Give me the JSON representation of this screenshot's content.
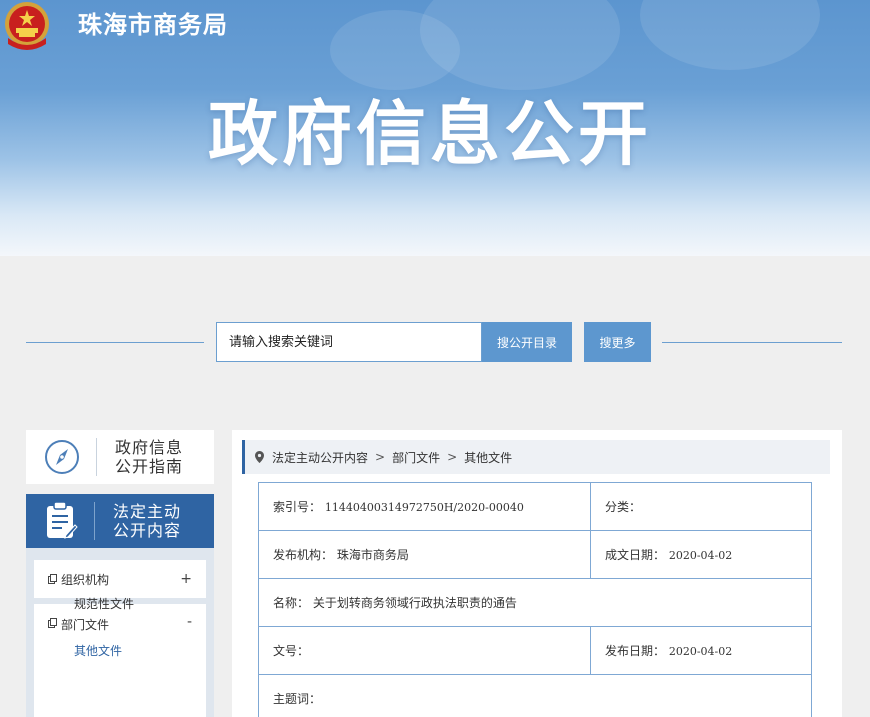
{
  "header": {
    "site_name": "珠海市商务局",
    "banner_title": "政府信息公开"
  },
  "search": {
    "placeholder": "请输入搜索关键词",
    "catalog_button": "搜公开目录",
    "more_button": "搜更多"
  },
  "sidebar": {
    "guide_label": "政府信息公开指南",
    "legal_label": "法定主动公开内容",
    "menu": [
      {
        "label": "组织机构",
        "toggle": "+"
      },
      {
        "label": "部门文件",
        "toggle": "-"
      }
    ],
    "submenu": [
      "规范性文件",
      "其他文件"
    ]
  },
  "breadcrumb": {
    "items": [
      "法定主动公开内容",
      "部门文件",
      "其他文件"
    ],
    "separator": ">"
  },
  "details": {
    "index_label": "索引号：",
    "index_value": "11440400314972750H/2020-00040",
    "category_label": "分类：",
    "category_value": "",
    "publisher_label": "发布机构：",
    "publisher_value": "珠海市商务局",
    "created_label": "成文日期：",
    "created_value": "2020-04-02",
    "name_label": "名称：",
    "name_value": "关于划转商务领域行政执法职责的通告",
    "docno_label": "文号：",
    "docno_value": "",
    "published_label": "发布日期：",
    "published_value": "2020-04-02",
    "subject_label": "主题词：",
    "subject_value": ""
  },
  "colors": {
    "primary_blue": "#2f64a3",
    "button_blue": "#5d97cf",
    "table_border": "#7fa8d4"
  }
}
